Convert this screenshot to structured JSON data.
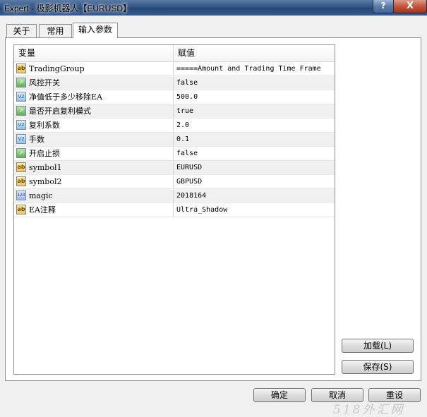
{
  "window": {
    "title": "Expert - 极影机器人【EURUSD】",
    "help_label": "?",
    "close_label": "X"
  },
  "tabs": [
    {
      "label": "关于"
    },
    {
      "label": "常用"
    },
    {
      "label": "输入参数"
    }
  ],
  "grid": {
    "headers": {
      "variable": "变量",
      "value": "赋值"
    },
    "rows": [
      {
        "icon": "string-icon",
        "label": "TradingGroup",
        "value": "=====Amount and Trading Time Frame"
      },
      {
        "icon": "bool-icon",
        "label": "风控开关",
        "value": "false"
      },
      {
        "icon": "double-icon",
        "label": "净值低于多少移除EA",
        "value": "500.0"
      },
      {
        "icon": "bool-icon",
        "label": "是否开启复利模式",
        "value": "true"
      },
      {
        "icon": "double-icon",
        "label": "复利系数",
        "value": "2.0"
      },
      {
        "icon": "double-icon",
        "label": "手数",
        "value": "0.1"
      },
      {
        "icon": "bool-icon",
        "label": "开启止损",
        "value": "false"
      },
      {
        "icon": "string-icon",
        "label": "symbol1",
        "value": "EURUSD"
      },
      {
        "icon": "string-icon",
        "label": "symbol2",
        "value": "GBPUSD"
      },
      {
        "icon": "int-icon",
        "label": "magic",
        "value": "2018164"
      },
      {
        "icon": "string-icon",
        "label": "EA注释",
        "value": "Ultra_Shadow"
      }
    ]
  },
  "buttons": {
    "load": "加载(L)",
    "save": "保存(S)",
    "ok": "确定",
    "cancel": "取消",
    "reset": "重设"
  },
  "watermark": "518外汇网"
}
